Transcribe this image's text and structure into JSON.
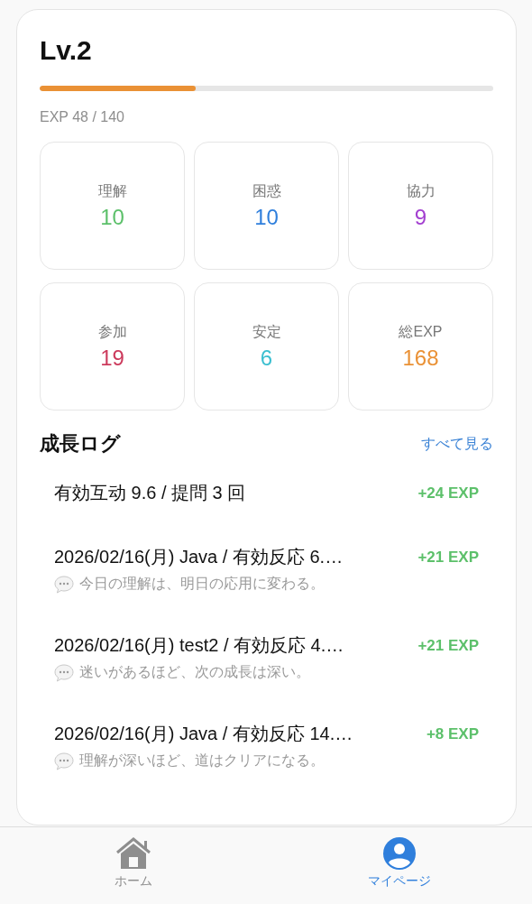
{
  "level": {
    "title": "Lv.2",
    "level": 0.343,
    "exp_text": "EXP 48 / 140"
  },
  "stats": [
    {
      "label": "理解",
      "value": "10",
      "color": "#5cc06a"
    },
    {
      "label": "困惑",
      "value": "10",
      "color": "#2f7fdc"
    },
    {
      "label": "協力",
      "value": "9",
      "color": "#a33fd0"
    },
    {
      "label": "参加",
      "value": "19",
      "color": "#cc3a5c"
    },
    {
      "label": "安定",
      "value": "6",
      "color": "#3bbfd0"
    },
    {
      "label": "総EXP",
      "value": "168",
      "color": "#ea9135"
    }
  ],
  "growth_log": {
    "title": "成長ログ",
    "link": "すべて見る",
    "items": [
      {
        "text": "有効互动 9.6 / 提問 3 回",
        "exp": "+24 EXP"
      },
      {
        "text": "2026/02/16(月) Java / 有効反応 6.…",
        "exp": "+21 EXP",
        "quote": "今日の理解は、明日の応用に変わる。"
      },
      {
        "text": "2026/02/16(月) test2 / 有効反応 4.…",
        "exp": "+21 EXP",
        "quote": "迷いがあるほど、次の成長は深い。"
      },
      {
        "text": "2026/02/16(月) Java / 有効反応 14.…",
        "exp": "+8 EXP",
        "quote": "理解が深いほど、道はクリアになる。"
      }
    ]
  },
  "tab_bar": [
    {
      "kind": "home",
      "label": "ホーム",
      "selected": false
    },
    {
      "kind": "profile",
      "label": "マイページ",
      "selected": true
    }
  ]
}
